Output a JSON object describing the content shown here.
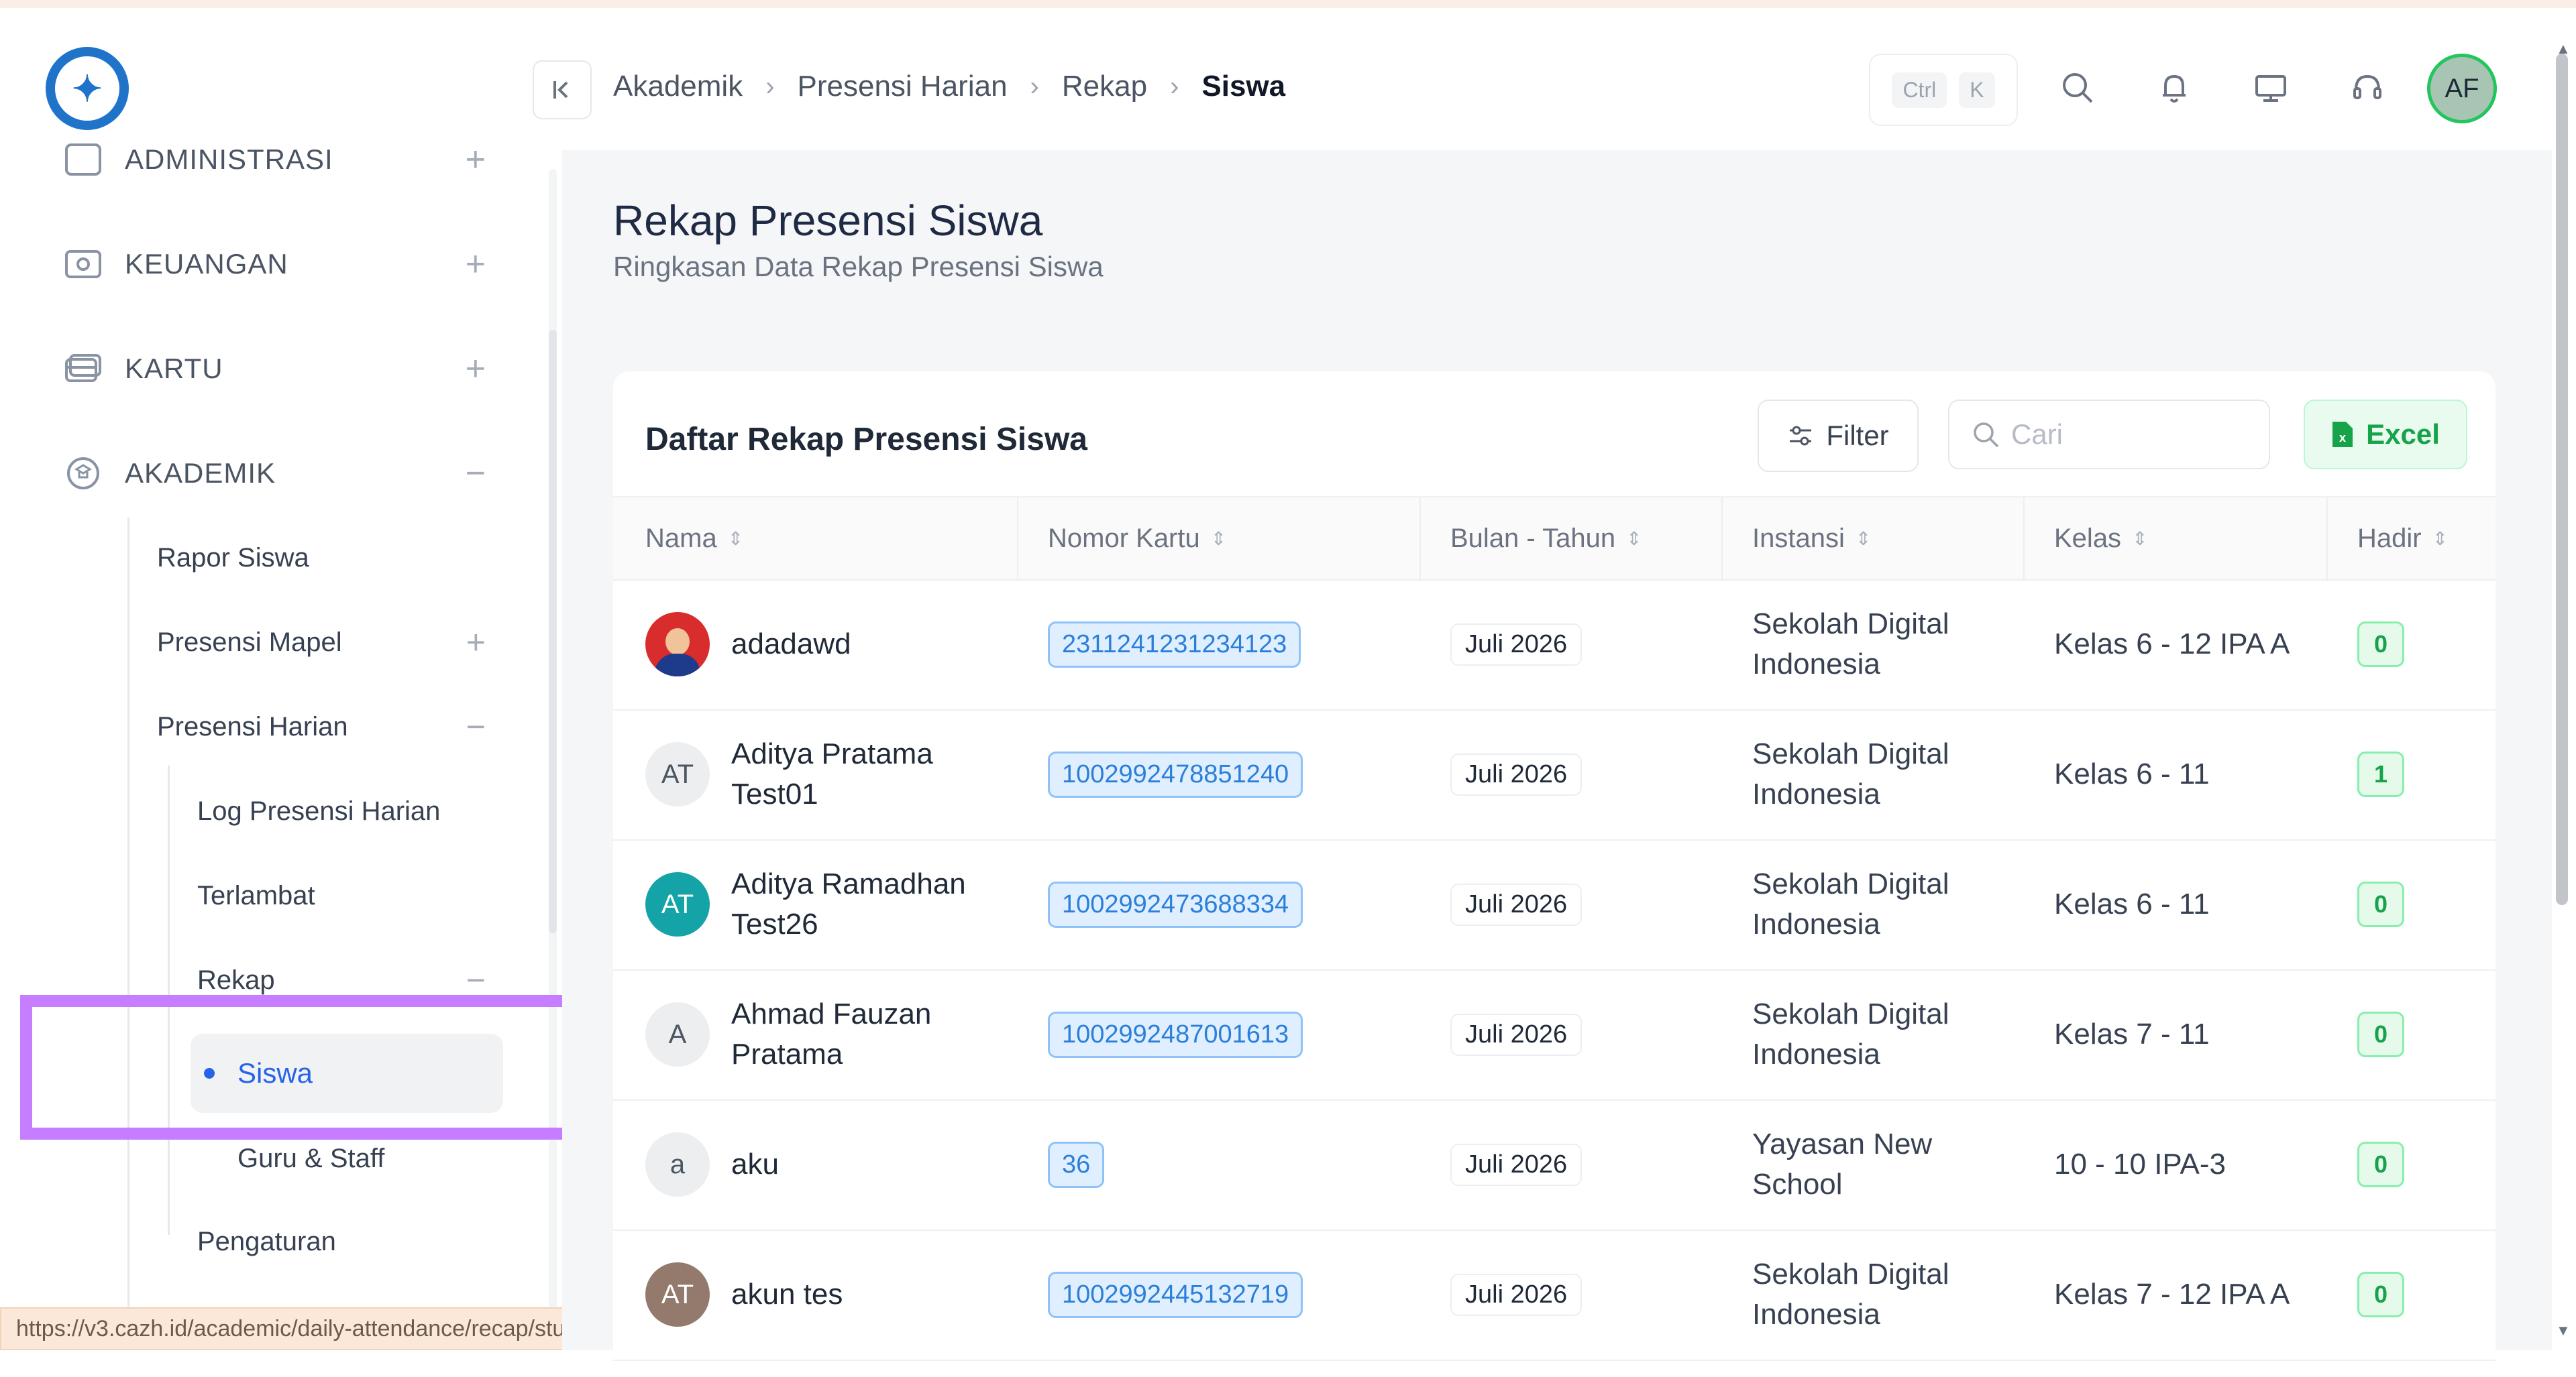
{
  "breadcrumb": [
    "Akademik",
    "Presensi Harian",
    "Rekap",
    "Siswa"
  ],
  "shortcut": {
    "ctrl": "Ctrl",
    "key": "K"
  },
  "user": {
    "initials": "AF"
  },
  "sidebar": {
    "sections": [
      {
        "label": "ADMINISTRASI",
        "icon": "document-icon",
        "state": "+"
      },
      {
        "label": "KEUANGAN",
        "icon": "money-icon",
        "state": "+"
      },
      {
        "label": "KARTU",
        "icon": "card-icon",
        "state": "+"
      },
      {
        "label": "AKADEMIK",
        "icon": "academic-icon",
        "state": "−"
      }
    ],
    "akademik_items": [
      {
        "label": "Rapor Siswa",
        "state": ""
      },
      {
        "label": "Presensi Mapel",
        "state": "+"
      },
      {
        "label": "Presensi Harian",
        "state": "−"
      }
    ],
    "presensi_harian_items": [
      {
        "label": "Log Presensi Harian"
      },
      {
        "label": "Terlambat"
      },
      {
        "label": "Rekap",
        "state": "−"
      }
    ],
    "rekap_items": [
      {
        "label": "Siswa",
        "active": true
      },
      {
        "label": "Guru & Staff"
      }
    ],
    "pengaturan": "Pengaturan"
  },
  "status_url": "https://v3.cazh.id/academic/daily-attendance/recap/student",
  "page": {
    "title": "Rekap Presensi Siswa",
    "subtitle": "Ringkasan Data Rekap Presensi Siswa"
  },
  "card": {
    "title": "Daftar Rekap Presensi Siswa",
    "filter_label": "Filter",
    "search_placeholder": "Cari",
    "excel_label": "Excel"
  },
  "table": {
    "columns": [
      "Nama",
      "Nomor Kartu",
      "Bulan - Tahun",
      "Instansi",
      "Kelas",
      "Hadir"
    ],
    "rows": [
      {
        "avatar": "",
        "avatar_type": "photo",
        "name": [
          "adadawd"
        ],
        "card": "2311241231234123",
        "month": "Juli 2026",
        "inst": [
          "Sekolah Digital",
          "Indonesia"
        ],
        "kelas": "Kelas 6 - 12 IPA A",
        "hadir": "0"
      },
      {
        "avatar": "AT",
        "avatar_type": "light",
        "name": [
          "Aditya Pratama",
          "Test01"
        ],
        "card": "1002992478851240",
        "month": "Juli 2026",
        "inst": [
          "Sekolah Digital",
          "Indonesia"
        ],
        "kelas": "Kelas 6 - 11",
        "hadir": "1"
      },
      {
        "avatar": "AT",
        "avatar_type": "teal",
        "name": [
          "Aditya Ramadhan",
          "Test26"
        ],
        "card": "1002992473688334",
        "month": "Juli 2026",
        "inst": [
          "Sekolah Digital",
          "Indonesia"
        ],
        "kelas": "Kelas 6 - 11",
        "hadir": "0"
      },
      {
        "avatar": "A",
        "avatar_type": "light",
        "name": [
          "Ahmad Fauzan",
          "Pratama"
        ],
        "card": "1002992487001613",
        "month": "Juli 2026",
        "inst": [
          "Sekolah Digital",
          "Indonesia"
        ],
        "kelas": "Kelas 7 - 11",
        "hadir": "0"
      },
      {
        "avatar": "a",
        "avatar_type": "light",
        "name": [
          "aku"
        ],
        "card": "36",
        "month": "Juli 2026",
        "inst": [
          "Yayasan New",
          "School"
        ],
        "kelas": "10 - 10 IPA-3",
        "hadir": "0"
      },
      {
        "avatar": "AT",
        "avatar_type": "brown",
        "name": [
          "akun tes"
        ],
        "card": "1002992445132719",
        "month": "Juli 2026",
        "inst": [
          "Sekolah Digital",
          "Indonesia"
        ],
        "kelas": "Kelas 7 - 12 IPA A",
        "hadir": "0"
      }
    ]
  }
}
